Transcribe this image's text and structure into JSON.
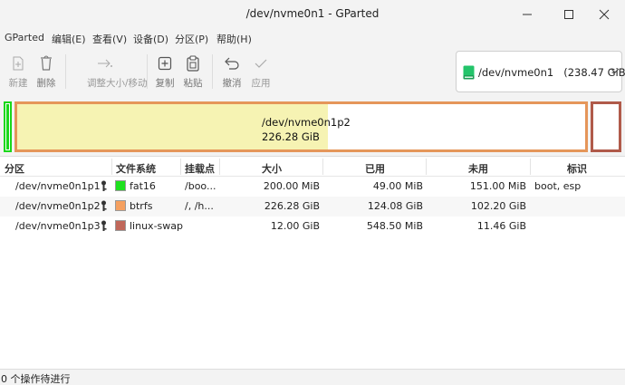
{
  "window": {
    "title": "/dev/nvme0n1 - GParted"
  },
  "menu": [
    "GParted",
    "编辑(E)",
    "查看(V)",
    "设备(D)",
    "分区(P)",
    "帮助(H)"
  ],
  "toolbar": {
    "new": "新建",
    "delete": "删除",
    "resize_move": "调整大小/移动",
    "copy": "复制",
    "paste": "粘贴",
    "undo": "撤消",
    "apply": "应用"
  },
  "device_selector": {
    "device": "/dev/nvme0n1",
    "size": "(238.47 GiB)",
    "icon": "disk-icon",
    "icon_color": "#23c46a"
  },
  "disk_map": {
    "selected_name": "/dev/nvme0n1p2",
    "selected_size": "226.28 GiB"
  },
  "table": {
    "headers": [
      "分区",
      "文件系统",
      "挂载点",
      "大小",
      "已用",
      "未用",
      "标识"
    ],
    "rows": [
      {
        "partition": "/dev/nvme0n1p1",
        "fs": "fat16",
        "fs_color": "#1ee11e",
        "mount": "/boo...",
        "size": "200.00 MiB",
        "used": "49.00 MiB",
        "unused": "151.00 MiB",
        "flags": "boot, esp"
      },
      {
        "partition": "/dev/nvme0n1p2",
        "fs": "btrfs",
        "fs_color": "#f5a060",
        "mount": "/, /h...",
        "size": "226.28 GiB",
        "used": "124.08 GiB",
        "unused": "102.20 GiB",
        "flags": ""
      },
      {
        "partition": "/dev/nvme0n1p3",
        "fs": "linux-swap",
        "fs_color": "#c0675a",
        "mount": "",
        "size": "12.00 GiB",
        "used": "548.50 MiB",
        "unused": "11.46 GiB",
        "flags": ""
      }
    ]
  },
  "status": {
    "text": "0 个操作待进行"
  }
}
